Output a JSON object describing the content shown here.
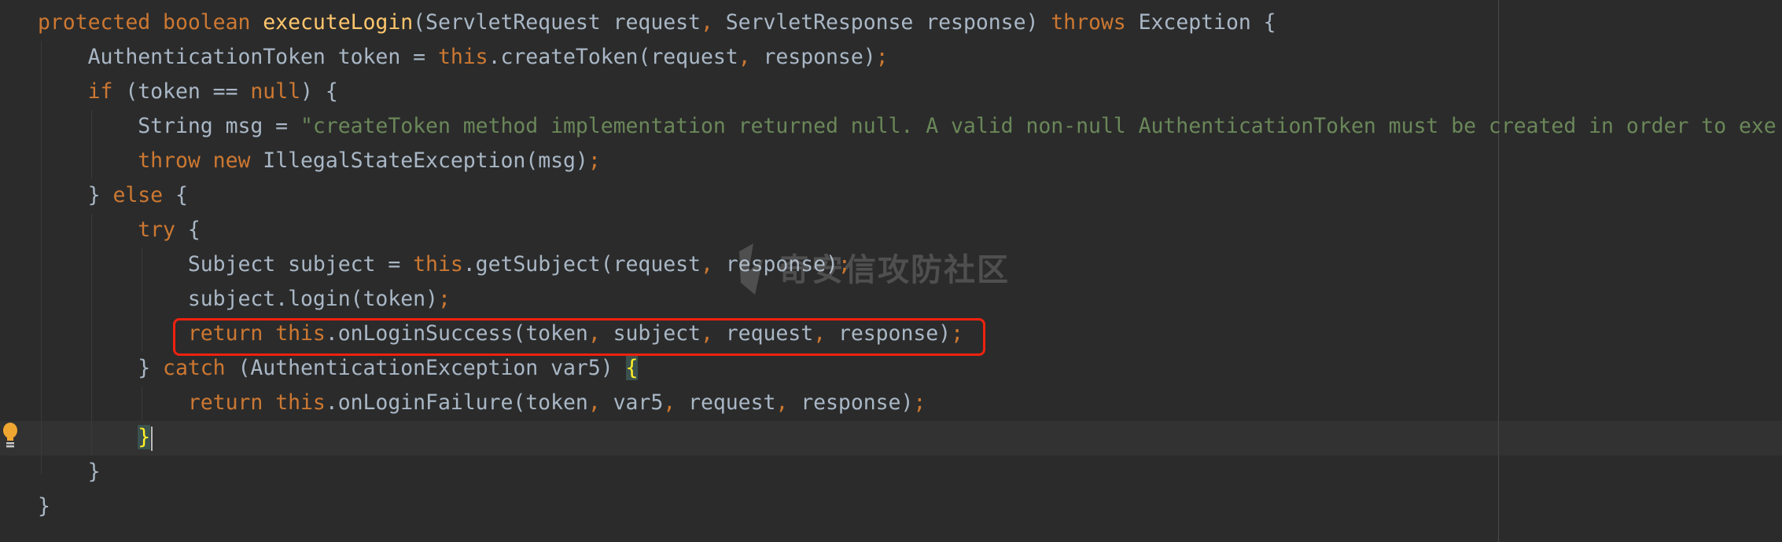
{
  "colors": {
    "background": "#2b2b2b",
    "keyword": "#cc7832",
    "identifier": "#a9b7c6",
    "method": "#ffc66d",
    "string": "#6a8759",
    "highlight_box": "#f0220f",
    "current_line": "#323232"
  },
  "watermark": {
    "text": "奇安信攻防社区",
    "icon": "shield-logo-icon"
  },
  "code": {
    "lines": [
      [
        [
          "kw",
          "protected boolean "
        ],
        [
          "fn",
          "executeLogin"
        ],
        [
          "t",
          "(ServletRequest request"
        ],
        [
          "punc",
          ", "
        ],
        [
          "t",
          "ServletResponse response) "
        ],
        [
          "kw",
          "throws "
        ],
        [
          "t",
          "Exception {"
        ]
      ],
      [
        [
          "t",
          "    AuthenticationToken token = "
        ],
        [
          "kw",
          "this"
        ],
        [
          "t",
          ".createToken(request"
        ],
        [
          "punc",
          ", "
        ],
        [
          "t",
          "response)"
        ],
        [
          "punc",
          ";"
        ]
      ],
      [
        [
          "t",
          "    "
        ],
        [
          "kw",
          "if "
        ],
        [
          "t",
          "(token == "
        ],
        [
          "kw",
          "null"
        ],
        [
          "t",
          ") {"
        ]
      ],
      [
        [
          "t",
          "        String msg = "
        ],
        [
          "str",
          "\"createToken method implementation returned null. A valid non-null AuthenticationToken must be created in order to exe"
        ]
      ],
      [
        [
          "t",
          "        "
        ],
        [
          "kw",
          "throw new "
        ],
        [
          "t",
          "IllegalStateException(msg)"
        ],
        [
          "punc",
          ";"
        ]
      ],
      [
        [
          "t",
          "    } "
        ],
        [
          "kw",
          "else "
        ],
        [
          "t",
          "{"
        ]
      ],
      [
        [
          "t",
          "        "
        ],
        [
          "kw",
          "try "
        ],
        [
          "t",
          "{"
        ]
      ],
      [
        [
          "t",
          "            Subject subject = "
        ],
        [
          "kw",
          "this"
        ],
        [
          "t",
          ".getSubject(request"
        ],
        [
          "punc",
          ", "
        ],
        [
          "t",
          "response)"
        ],
        [
          "punc",
          ";"
        ]
      ],
      [
        [
          "t",
          "            subject.login(token)"
        ],
        [
          "punc",
          ";"
        ]
      ],
      [
        [
          "t",
          "            "
        ],
        [
          "kw",
          "return this"
        ],
        [
          "t",
          ".onLoginSuccess(token"
        ],
        [
          "punc",
          ", "
        ],
        [
          "t",
          "subject"
        ],
        [
          "punc",
          ", "
        ],
        [
          "t",
          "request"
        ],
        [
          "punc",
          ", "
        ],
        [
          "t",
          "response)"
        ],
        [
          "punc",
          ";"
        ]
      ],
      [
        [
          "t",
          "        } "
        ],
        [
          "kw",
          "catch "
        ],
        [
          "t",
          "(AuthenticationException var5) "
        ],
        [
          "hl",
          "{"
        ]
      ],
      [
        [
          "t",
          "            "
        ],
        [
          "kw",
          "return this"
        ],
        [
          "t",
          ".onLoginFailure(token"
        ],
        [
          "punc",
          ", "
        ],
        [
          "t",
          "var5"
        ],
        [
          "punc",
          ", "
        ],
        [
          "t",
          "request"
        ],
        [
          "punc",
          ", "
        ],
        [
          "t",
          "response)"
        ],
        [
          "punc",
          ";"
        ]
      ],
      [
        [
          "t",
          "        "
        ],
        [
          "hl",
          "}"
        ]
      ],
      [
        [
          "t",
          "    }"
        ]
      ],
      [
        [
          "t",
          "}"
        ]
      ]
    ]
  }
}
